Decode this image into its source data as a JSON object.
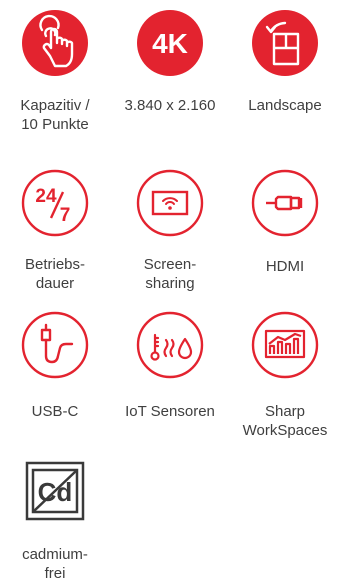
{
  "colors": {
    "brand": "#e3232f",
    "text": "#3f3f3f",
    "badge": "#3a3a3a"
  },
  "features": [
    {
      "icon": "touch-hand-icon",
      "label_lines": [
        "Kapazitiv /",
        "10 Punkte"
      ]
    },
    {
      "icon": "4k-badge-icon",
      "badge": "4K",
      "label_lines": [
        "3.840 x 2.160"
      ]
    },
    {
      "icon": "landscape-rotate-icon",
      "label_lines": [
        "Landscape"
      ]
    },
    {
      "icon": "24-7-icon",
      "badge_top": "24",
      "badge_bottom": "7",
      "label_lines": [
        "Betriebs-",
        "dauer"
      ]
    },
    {
      "icon": "screensharing-icon",
      "label_lines": [
        "Screen-",
        "sharing"
      ]
    },
    {
      "icon": "hdmi-icon",
      "label_lines": [
        "HDMI"
      ]
    },
    {
      "icon": "usb-c-icon",
      "label_lines": [
        "USB-C"
      ]
    },
    {
      "icon": "iot-sensors-icon",
      "label_lines": [
        "IoT Sensoren"
      ]
    },
    {
      "icon": "sharp-workspaces-icon",
      "label_lines": [
        "Sharp",
        "WorkSpaces"
      ]
    },
    {
      "icon": "cadmium-free-icon",
      "badge": "Cd",
      "label_lines": [
        "cadmium-",
        "frei"
      ]
    }
  ]
}
